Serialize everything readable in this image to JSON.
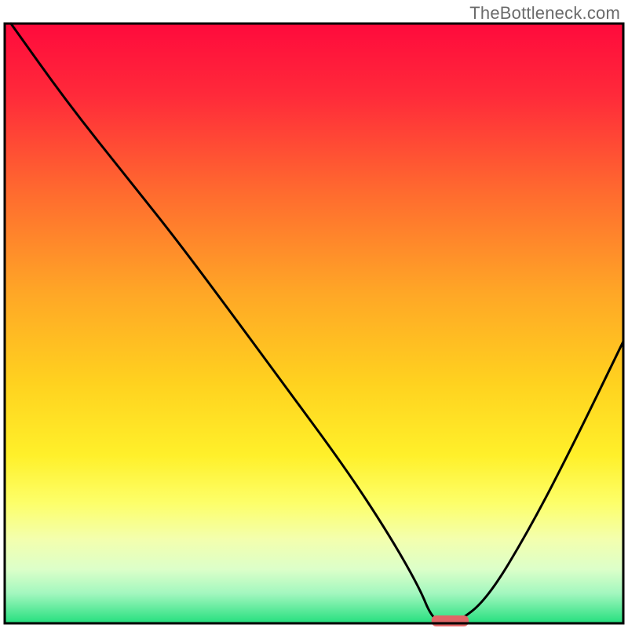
{
  "watermark": "TheBottleneck.com",
  "chart_data": {
    "type": "line",
    "title": "",
    "xlabel": "",
    "ylabel": "",
    "xlim": [
      0,
      100
    ],
    "ylim": [
      0,
      100
    ],
    "series": [
      {
        "name": "bottleneck-curve",
        "x": [
          1,
          10,
          20,
          27,
          35,
          45,
          55,
          62,
          67,
          69,
          71,
          73,
          78,
          85,
          92,
          100
        ],
        "values": [
          100,
          87,
          74,
          65,
          54,
          40,
          26,
          15,
          6,
          1,
          0,
          0,
          4,
          16,
          30,
          47
        ]
      }
    ],
    "marker": {
      "name": "optimal-zone",
      "x_center": 72,
      "width": 6,
      "y": 0,
      "color": "#e06666"
    },
    "background_gradient": {
      "stops": [
        {
          "offset": 0,
          "color": "#ff0a3c"
        },
        {
          "offset": 12,
          "color": "#ff2a3a"
        },
        {
          "offset": 28,
          "color": "#ff6a2f"
        },
        {
          "offset": 45,
          "color": "#ffa726"
        },
        {
          "offset": 60,
          "color": "#ffd21f"
        },
        {
          "offset": 72,
          "color": "#fff02a"
        },
        {
          "offset": 80,
          "color": "#fdff6a"
        },
        {
          "offset": 86,
          "color": "#f3ffae"
        },
        {
          "offset": 91,
          "color": "#dcffc9"
        },
        {
          "offset": 95,
          "color": "#a3f7bf"
        },
        {
          "offset": 100,
          "color": "#24df7e"
        }
      ]
    },
    "frame_color": "#000000",
    "curve_color": "#000000"
  }
}
